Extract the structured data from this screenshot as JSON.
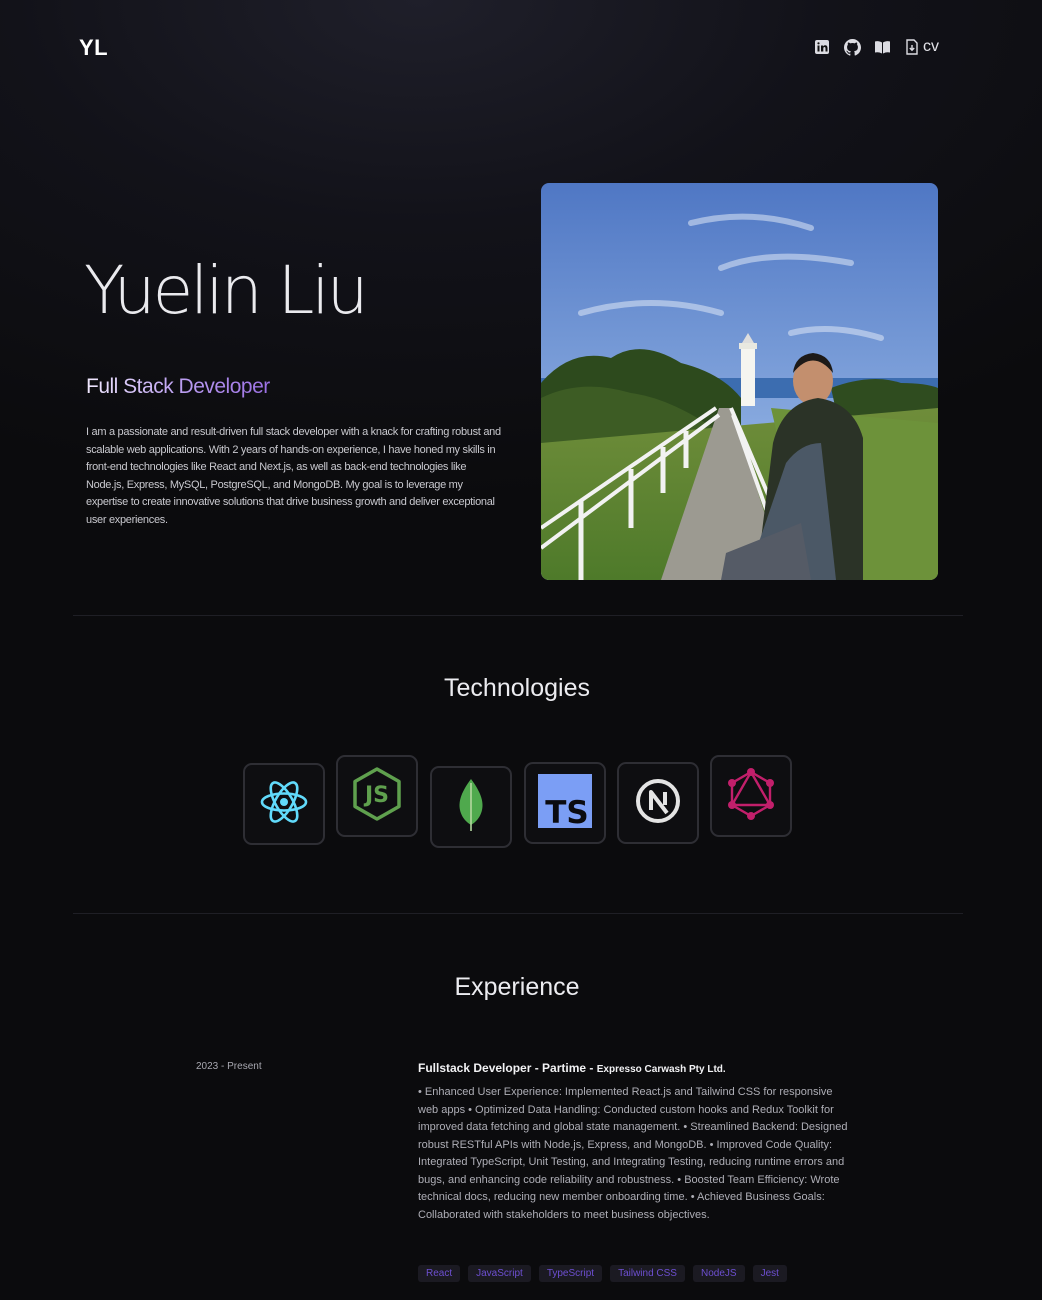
{
  "header": {
    "logo": "YL",
    "icons": [
      "linkedin-icon",
      "github-icon",
      "book-icon",
      "file-download-icon"
    ],
    "cv_label": "cv"
  },
  "hero": {
    "name": "Yuelin Liu",
    "role": "Full Stack Developer",
    "bio": "I am a passionate and result-driven full stack developer with a knack for crafting robust and scalable web applications. With 2 years of hands-on experience, I have honed my skills in front-end technologies like React and Next.js, as well as back-end technologies like Node.js, Express, MySQL, PostgreSQL, and MongoDB. My goal is to leverage my expertise to create innovative solutions that drive business growth and deliver exceptional user experiences."
  },
  "technologies": {
    "title": "Technologies",
    "items": [
      {
        "name": "React",
        "icon": "react-icon",
        "color": "#61dafb"
      },
      {
        "name": "Node.js",
        "icon": "nodejs-icon",
        "color": "#5fa04e"
      },
      {
        "name": "MongoDB",
        "icon": "mongodb-icon",
        "color": "#4fa94d"
      },
      {
        "name": "TypeScript",
        "icon": "typescript-icon",
        "color": "#7b9ef5"
      },
      {
        "name": "Next.js",
        "icon": "nextjs-icon",
        "color": "#e4e4e4"
      },
      {
        "name": "GraphQL",
        "icon": "graphql-icon",
        "color": "#c21f6b"
      }
    ]
  },
  "experience": {
    "title": "Experience",
    "items": [
      {
        "date": "2023 - Present",
        "role": "Fullstack Developer - Partime - ",
        "company": "Expresso Carwash Pty Ltd.",
        "description": "• Enhanced User Experience: Implemented React.js and Tailwind CSS for responsive web apps • Optimized Data Handling: Conducted custom hooks and Redux Toolkit for improved data fetching and global state management. • Streamlined Backend: Designed robust RESTful APIs with Node.js, Express, and MongoDB. • Improved Code Quality: Integrated TypeScript, Unit Testing, and Integrating Testing, reducing runtime errors and bugs, and enhancing code reliability and robustness. • Boosted Team Efficiency: Wrote technical docs, reducing new member onboarding time. • Achieved Business Goals: Collaborated with stakeholders to meet business objectives.",
        "tags": [
          "React",
          "JavaScript",
          "TypeScript",
          "Tailwind CSS",
          "NodeJS",
          "Jest"
        ]
      }
    ]
  },
  "colors": {
    "background": "#0c0c0f",
    "accent_purple": "#9a6fe3",
    "tag_text": "#6d4fd1"
  }
}
